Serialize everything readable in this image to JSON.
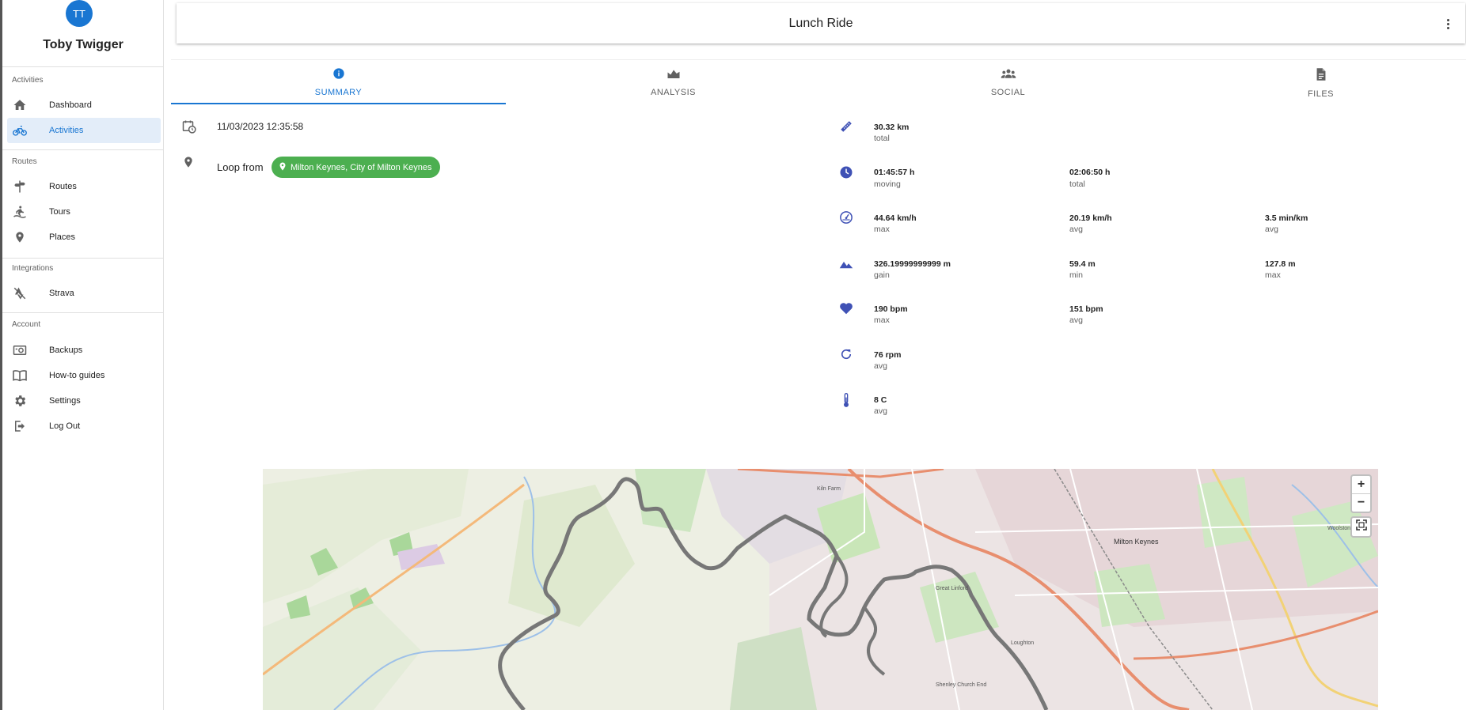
{
  "sidebar": {
    "avatar_initials": "TT",
    "user_name": "Toby Twigger",
    "sections": {
      "activities": "Activities",
      "routes": "Routes",
      "integrations": "Integrations",
      "account": "Account"
    },
    "items": {
      "dashboard": "Dashboard",
      "activities": "Activities",
      "routes": "Routes",
      "tours": "Tours",
      "places": "Places",
      "strava": "Strava",
      "backups": "Backups",
      "howto": "How-to guides",
      "settings": "Settings",
      "logout": "Log Out"
    },
    "active_item": "activities"
  },
  "header": {
    "title": "Lunch Ride"
  },
  "tabs": [
    {
      "label": "SUMMARY",
      "active": true,
      "icon": "info-icon"
    },
    {
      "label": "ANALYSIS",
      "active": false,
      "icon": "area-chart-icon"
    },
    {
      "label": "SOCIAL",
      "active": false,
      "icon": "people-icon"
    },
    {
      "label": "FILES",
      "active": false,
      "icon": "file-icon"
    }
  ],
  "summary": {
    "datetime": "11/03/2023 12:35:58",
    "loop_from": "Loop from",
    "place": "Milton Keynes, City of Milton Keynes"
  },
  "stats": {
    "distance": {
      "value": "30.32 km",
      "label": "total"
    },
    "time": [
      {
        "value": "01:45:57 h",
        "label": "moving"
      },
      {
        "value": "02:06:50 h",
        "label": "total"
      }
    ],
    "speed": [
      {
        "value": "44.64 km/h",
        "label": "max"
      },
      {
        "value": "20.19 km/h",
        "label": "avg"
      },
      {
        "value": "3.5 min/km",
        "label": "avg"
      }
    ],
    "elevation": [
      {
        "value": "326.19999999999 m",
        "label": "gain"
      },
      {
        "value": "59.4 m",
        "label": "min"
      },
      {
        "value": "127.8 m",
        "label": "max"
      }
    ],
    "heart_rate": [
      {
        "value": "190 bpm",
        "label": "max"
      },
      {
        "value": "151 bpm",
        "label": "avg"
      }
    ],
    "cadence": {
      "value": "76 rpm",
      "label": "avg"
    },
    "temperature": {
      "value": "8 C",
      "label": "avg"
    }
  },
  "map": {
    "zoom_in": "+",
    "zoom_out": "−",
    "labels": {
      "milton_keynes": "Milton Keynes",
      "kiln_farm": "Kiln Farm",
      "loughton": "Loughton",
      "great_linford": "Great Linford",
      "woolstone": "Woolstone",
      "shenley": "Shenley Church End"
    }
  }
}
